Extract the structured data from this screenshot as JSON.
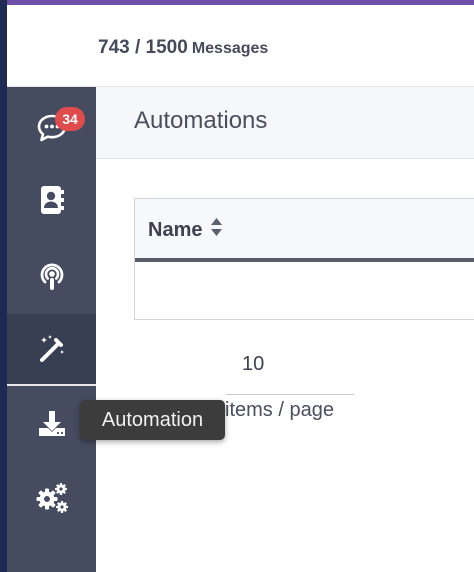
{
  "topbar": {
    "message_count": "743 / 1500",
    "message_unit": "Messages"
  },
  "sidebar": {
    "items": [
      {
        "name": "messages",
        "icon": "chat-icon",
        "badge": "34"
      },
      {
        "name": "contacts",
        "icon": "contacts-icon"
      },
      {
        "name": "broadcast",
        "icon": "podcast-icon"
      },
      {
        "name": "automation",
        "icon": "magic-wand-icon",
        "active": true
      },
      {
        "name": "import",
        "icon": "download-icon"
      },
      {
        "name": "settings",
        "icon": "gears-icon"
      }
    ]
  },
  "header": {
    "title": "Automations"
  },
  "table": {
    "columns": [
      "Name"
    ]
  },
  "pagination": {
    "page_size": "10",
    "label": "items / page"
  },
  "tooltip": {
    "text": "Automation"
  },
  "colors": {
    "sidebar_bg": "#464c60",
    "badge": "#e04b4b",
    "accent": "#6e4fa8"
  }
}
